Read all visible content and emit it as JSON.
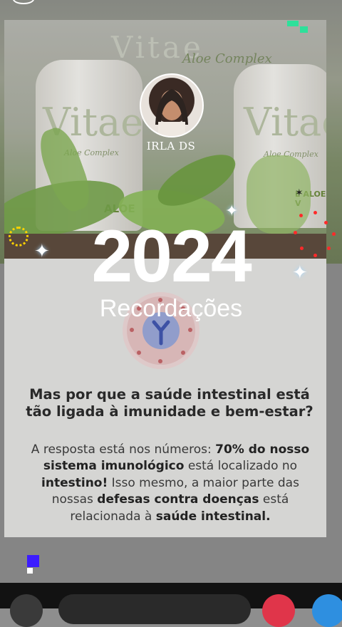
{
  "story": {
    "username": "IRLA DS",
    "year": "2024",
    "subtitle": "Recordações"
  },
  "background_photo": {
    "brand_watermark": "Vitae",
    "script_text": "Aloe Complex",
    "bottle_label_left": "Vitae",
    "bottle_label_right": "Vitae",
    "bottle_sub_left": "Aloe Complex",
    "bottle_sub_right": "Aloe Complex",
    "product_left": "ALOE",
    "product_right": "E ALOE V"
  },
  "post": {
    "question": "Mas por que a saúde intestinal está tão ligada à imunidade e bem-estar?",
    "answer_parts": [
      {
        "text": "A resposta está nos números: ",
        "bold": false
      },
      {
        "text": "70% do nosso sistema imunológico",
        "bold": true
      },
      {
        "text": " está localizado no ",
        "bold": false
      },
      {
        "text": "intestino!",
        "bold": true
      },
      {
        "text": " Isso mesmo, a maior parte das nossas ",
        "bold": false
      },
      {
        "text": "defesas contra doenças",
        "bold": true
      },
      {
        "text": " está relacionada à ",
        "bold": false
      },
      {
        "text": "saúde intestinal.",
        "bold": true
      }
    ]
  },
  "icons": {
    "sparkle": "sparkle-icon",
    "sun": "sun-sticker-icon",
    "avatar": "profile-avatar"
  },
  "colors": {
    "text_light": "#ffffff",
    "question": "#2a2a2a",
    "accent_green": "#2ee09a",
    "accent_red": "#ff2a2a",
    "accent_yellow": "#ffd400",
    "accent_blue": "#3c1cff"
  }
}
